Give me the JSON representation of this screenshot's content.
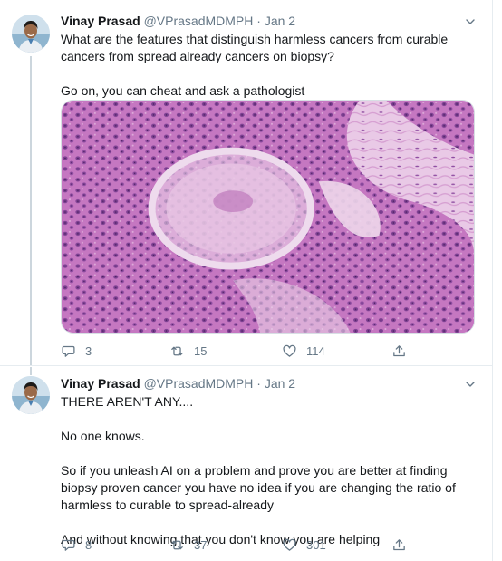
{
  "tweets": [
    {
      "author_name": "Vinay Prasad",
      "author_handle": "@VPrasadMDMPH",
      "date": "Jan 2",
      "paragraphs": [
        "What are the features that distinguish harmless cancers from curable cancers from spread already cancers on biopsy?",
        "Go on, you can cheat and ask a pathologist"
      ],
      "replies": "3",
      "retweets": "15",
      "likes": "114"
    },
    {
      "author_name": "Vinay Prasad",
      "author_handle": "@VPrasadMDMPH",
      "date": "Jan 2",
      "paragraphs": [
        "THERE AREN'T ANY....",
        "No one knows.",
        "So if you unleash AI on a problem and prove you are better at finding biopsy proven cancer you have no idea if you are changing the ratio of harmless to curable to spread-already",
        "And without knowing that you don't know you are helping"
      ],
      "replies": "8",
      "retweets": "37",
      "likes": "301"
    }
  ],
  "separator": "·",
  "icons": {
    "reply": "speech-bubble-icon",
    "retweet": "retweet-arrows-icon",
    "like": "heart-icon",
    "share": "share-upload-icon",
    "more": "chevron-down-icon"
  },
  "colors": {
    "text": "#14171a",
    "muted": "#657786",
    "border": "#e6ecf0",
    "tissue_light": "#eedaf0",
    "tissue_pink": "#d48ccf",
    "tissue_purple": "#9c5fae",
    "nucleus": "#5d2f78"
  }
}
